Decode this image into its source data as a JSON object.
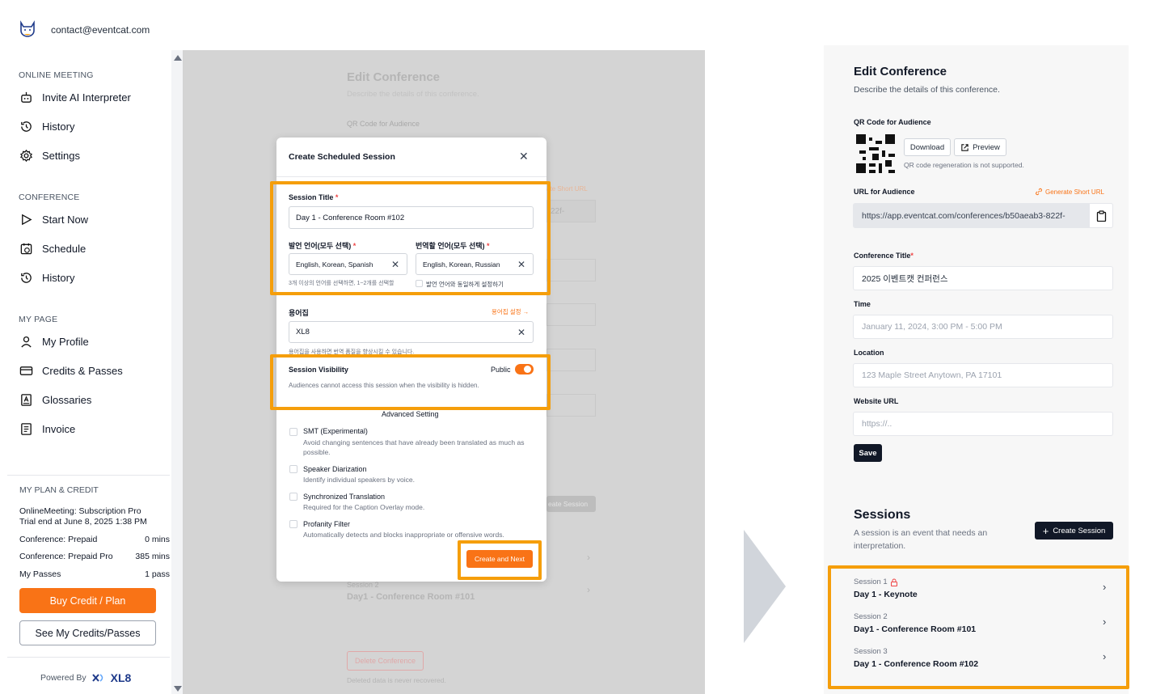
{
  "header": {
    "email": "contact@eventcat.com"
  },
  "sidebar": {
    "online_meeting_title": "ONLINE MEETING",
    "online_meeting_items": [
      {
        "label": "Invite AI Interpreter",
        "icon": "robot-icon"
      },
      {
        "label": "History",
        "icon": "history-icon"
      },
      {
        "label": "Settings",
        "icon": "gear-icon"
      }
    ],
    "conference_title": "CONFERENCE",
    "conference_items": [
      {
        "label": "Start Now",
        "icon": "play-icon"
      },
      {
        "label": "Schedule",
        "icon": "calendar-icon"
      },
      {
        "label": "History",
        "icon": "history-icon"
      }
    ],
    "mypage_title": "MY PAGE",
    "mypage_items": [
      {
        "label": "My Profile",
        "icon": "user-icon"
      },
      {
        "label": "Credits & Passes",
        "icon": "credit-card-icon"
      },
      {
        "label": "Glossaries",
        "icon": "glossary-icon"
      },
      {
        "label": "Invoice",
        "icon": "invoice-icon"
      }
    ],
    "plan": {
      "title": "MY PLAN & CREDIT",
      "subscription": "OnlineMeeting: Subscription Pro",
      "trial": "Trial end at June 8, 2025 1:38 PM",
      "rows": [
        {
          "label": "Conference: Prepaid",
          "value": "0 mins"
        },
        {
          "label": "Conference: Prepaid Pro",
          "value": "385 mins"
        },
        {
          "label": "My Passes",
          "value": "1 pass"
        }
      ],
      "buy_label": "Buy Credit / Plan",
      "see_label": "See My Credits/Passes"
    },
    "powered_by": "Powered By",
    "powered_brand": "XL8"
  },
  "background": {
    "title": "Edit Conference",
    "subtitle": "Describe the details of this conference.",
    "qr_label": "QR Code for Audience",
    "short_url": "ate Short URL",
    "url_tail": "22f-",
    "create_session": "eate Session",
    "session2_label": "Session 2",
    "session2_title": "Day1 - Conference Room #101",
    "delete_label": "Delete Conference",
    "delete_hint": "Deleted data is never recovered."
  },
  "modal": {
    "title": "Create Scheduled Session",
    "session_title_label": "Session Title",
    "session_title_value": "Day 1 - Conference Room #102",
    "source_lang_label": "발언 언어(모두 선택)",
    "source_lang_value": "English, Korean, Spanish",
    "target_lang_label": "번역할 언어(모두 선택)",
    "target_lang_value": "English, Korean, Russian",
    "lang_hint": "3개 이상의 언어를 선택하면, 1~2개를 선택할",
    "same_lang_label": "발언 언어와 동일하게 설정하기",
    "glossary_label": "용어집",
    "glossary_link": "용어집 설정 →",
    "glossary_value": "XL8",
    "glossary_hint": "용어집을 사용하면 번역 품질을 향상시킬 수 있습니다.",
    "visibility_label": "Session Visibility",
    "visibility_state": "Public",
    "visibility_hint": "Audiences cannot access this session when the visibility is hidden.",
    "advanced_label": "Advanced Setting",
    "advanced": [
      {
        "title": "SMT (Experimental)",
        "desc": "Avoid changing sentences that have already been translated as much as possible."
      },
      {
        "title": "Speaker Diarization",
        "desc": "Identify individual speakers by voice."
      },
      {
        "title": "Synchronized Translation",
        "desc": "Required for the Caption Overlay mode."
      },
      {
        "title": "Profanity Filter",
        "desc": "Automatically detects and blocks inappropriate or offensive words."
      }
    ],
    "next_label": "Create and Next"
  },
  "right": {
    "title": "Edit Conference",
    "subtitle": "Describe the details of this conference.",
    "qr_label": "QR Code for Audience",
    "download_label": "Download",
    "preview_label": "Preview",
    "qr_hint": "QR code regeneration is not supported.",
    "url_label": "URL for Audience",
    "short_url_label": "Generate Short URL",
    "url_value": "https://app.eventcat.com/conferences/b50aeab3-822f-",
    "conf_title_label": "Conference Title",
    "conf_title_value": "2025 이벤트캣 컨퍼런스",
    "time_label": "Time",
    "time_placeholder": "January 11, 2024, 3:00 PM - 5:00 PM",
    "location_label": "Location",
    "location_placeholder": "123 Maple Street Anytown, PA 17101",
    "website_label": "Website URL",
    "website_placeholder": "https://..",
    "save_label": "Save",
    "sessions_title": "Sessions",
    "sessions_desc": "A session is an event that needs an interpretation.",
    "create_session_label": "Create Session",
    "sessions": [
      {
        "name": "Session 1",
        "title": "Day 1 - Keynote"
      },
      {
        "name": "Session 2",
        "title": "Day1 - Conference Room #101"
      },
      {
        "name": "Session 3",
        "title": "Day 1 - Conference Room #102"
      }
    ]
  },
  "colors": {
    "accent": "#f97316",
    "highlight": "#f59e0b",
    "dark": "#111827"
  }
}
